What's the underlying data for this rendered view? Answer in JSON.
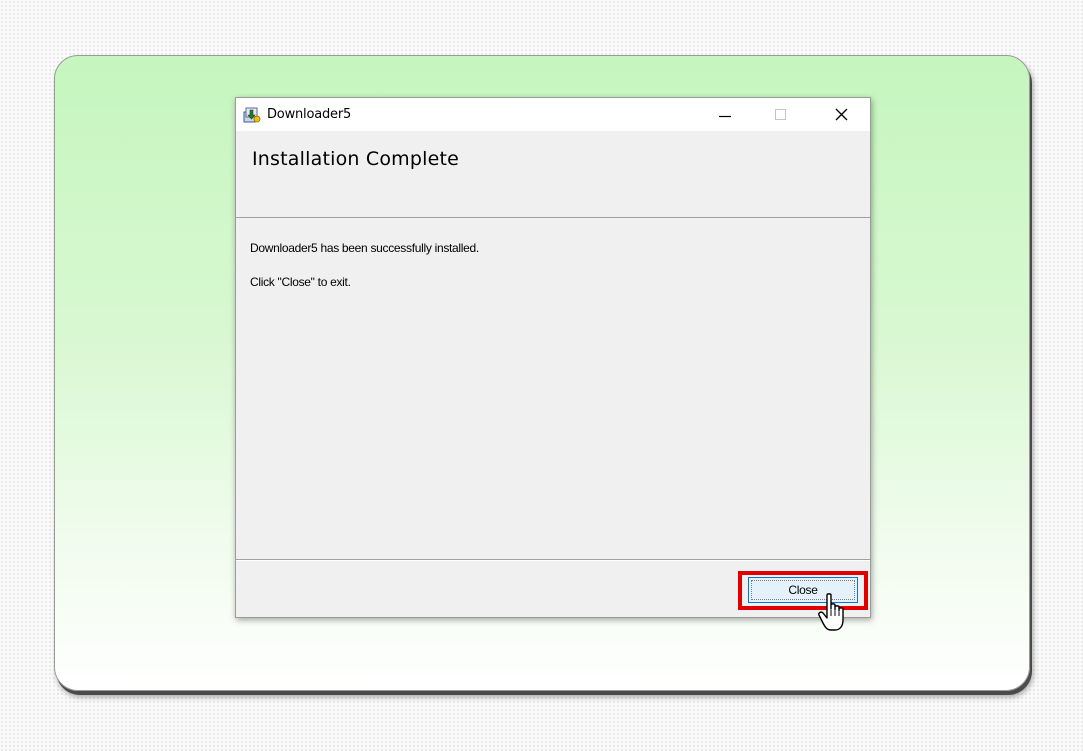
{
  "window": {
    "title": "Downloader5",
    "header_title": "Installation Complete",
    "message_lines": [
      "Downloader5 has been successfully installed.",
      "Click \"Close\" to exit."
    ],
    "close_button_label": "Close"
  },
  "titlebar_controls": [
    "minimize-icon",
    "maximize-icon",
    "close-icon"
  ],
  "colors": {
    "highlight": "#e00000",
    "button_border": "#0078d7",
    "panel_green": "#c5f6be"
  }
}
